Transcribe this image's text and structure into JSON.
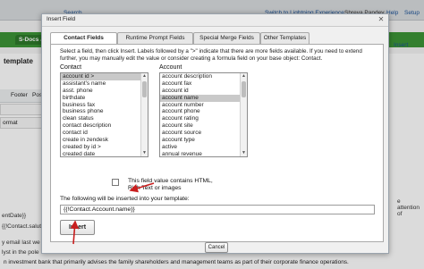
{
  "topbar": {
    "search": "Search",
    "switch_lightning": "Switch to Lightning Experience",
    "user": "Shreya Pandey",
    "help": "Help",
    "setup": "Setup"
  },
  "background": {
    "tab_label": "S-Docs J",
    "section_title": "template",
    "toolbar_items": [
      "Footer",
      "Pos"
    ],
    "format_label": "ormat",
    "code_line1": "entDate}}",
    "code_line2": "{{!Contact.salut",
    "email_text1": "y email last we",
    "email_text2": "lyst in the pole",
    "right_text1": "e attention of",
    "right_link": "Insert",
    "footer_text": "n investment bank that primarily advises the family shareholders and management teams as part of their corporate finance operations."
  },
  "dialog": {
    "title": "Insert Field",
    "close": "✕",
    "tabs": [
      "Contact Fields",
      "Runtime Prompt Fields",
      "Special Merge Fields",
      "Other Templates"
    ],
    "active_tab": 0,
    "instructions": "Select a field, then click Insert. Labels followed by a \">\" indicate that there are more fields available. If you need to extend further, you may manually edit the value or consider creating a formula field on your base object: Contact.",
    "contact_label": "Contact",
    "account_label": "Account",
    "contact_fields": [
      "account id >",
      "assistant's name",
      "asst. phone",
      "birthdate",
      "business fax",
      "business phone",
      "clean status",
      "contact description",
      "contact id",
      "create in zendesk",
      "created by id >",
      "created date"
    ],
    "contact_selected": 0,
    "account_fields": [
      "account description",
      "account fax",
      "account id",
      "account name",
      "account number",
      "account phone",
      "account rating",
      "account site",
      "account source",
      "account type",
      "active",
      "annual revenue"
    ],
    "account_selected": 3,
    "html_checkbox_label": "This field value contains HTML, Rich Text or images",
    "insert_caption": "The following will be inserted into your template:",
    "formula_value": "{{!Contact.Account.name}}",
    "insert_button": "Insert",
    "cancel_button": "Cancel"
  },
  "colors": {
    "tab_green": "#3c9436",
    "annotation_red": "#c81e1e",
    "selected_row": "#c9c9c9"
  }
}
